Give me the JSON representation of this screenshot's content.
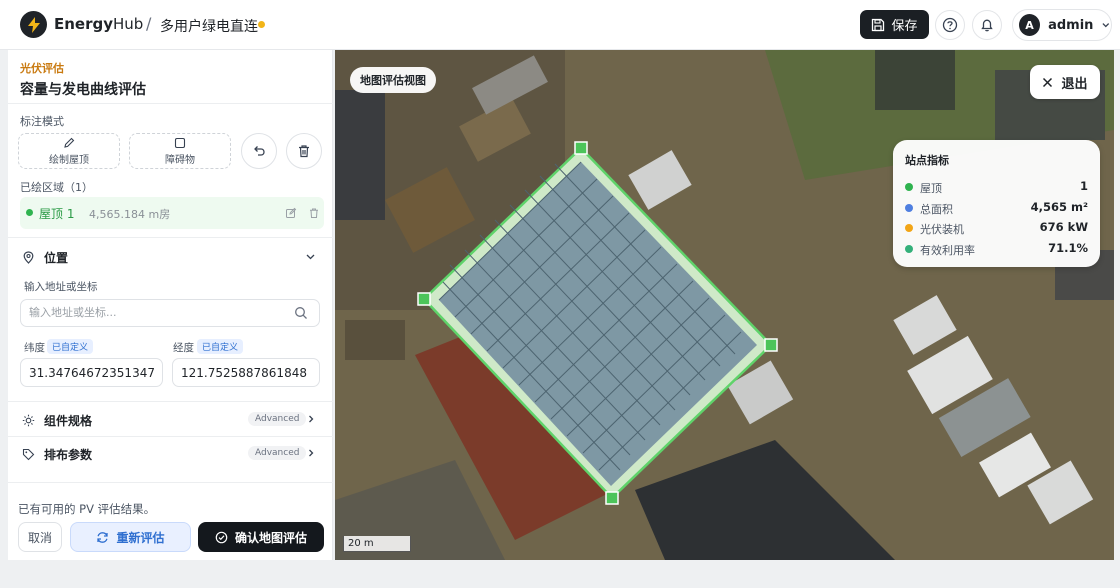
{
  "header": {
    "brand_bold": "Energy",
    "brand_light": "Hub",
    "breadcrumb_sep": "/",
    "breadcrumb": "多用户绿电直连",
    "save_label": "保存",
    "user_initial": "A",
    "user_name": "admin"
  },
  "panel": {
    "section_tag": "光伏评估",
    "section_title": "容量与发电曲线评估",
    "mode_label": "标注模式",
    "draw_roof": "绘制屋顶",
    "obstacle": "障碍物",
    "regions_label": "已绘区域（1）",
    "region": {
      "name": "屋顶 1",
      "area": "4,565.184 m房"
    },
    "location_title": "位置",
    "address_label": "输入地址或坐标",
    "search_placeholder": "输入地址或坐标...",
    "lat_label": "纬度",
    "lng_label": "经度",
    "custom_tag": "已自定义",
    "lat_value": "31.34764672351347",
    "lng_value": "121.7525887861848",
    "module_spec": "组件规格",
    "layout_params": "排布参数",
    "advanced": "Advanced",
    "status_text": "已有可用的 PV 评估结果。",
    "cancel": "取消",
    "reevaluate": "重新评估",
    "confirm": "确认地图评估"
  },
  "map": {
    "badge": "地图评估视图",
    "exit": "退出",
    "scale": "20 m",
    "stats_title": "站点指标",
    "stats": [
      {
        "label": "屋顶",
        "value": "1",
        "color": "#2fb34f"
      },
      {
        "label": "总面积",
        "value": "4,565 m²",
        "color": "#4f7fe0"
      },
      {
        "label": "光伏装机",
        "value": "676 kW",
        "color": "#f2a516"
      },
      {
        "label": "有效利用率",
        "value": "71.1%",
        "color": "#34b07a"
      }
    ]
  }
}
